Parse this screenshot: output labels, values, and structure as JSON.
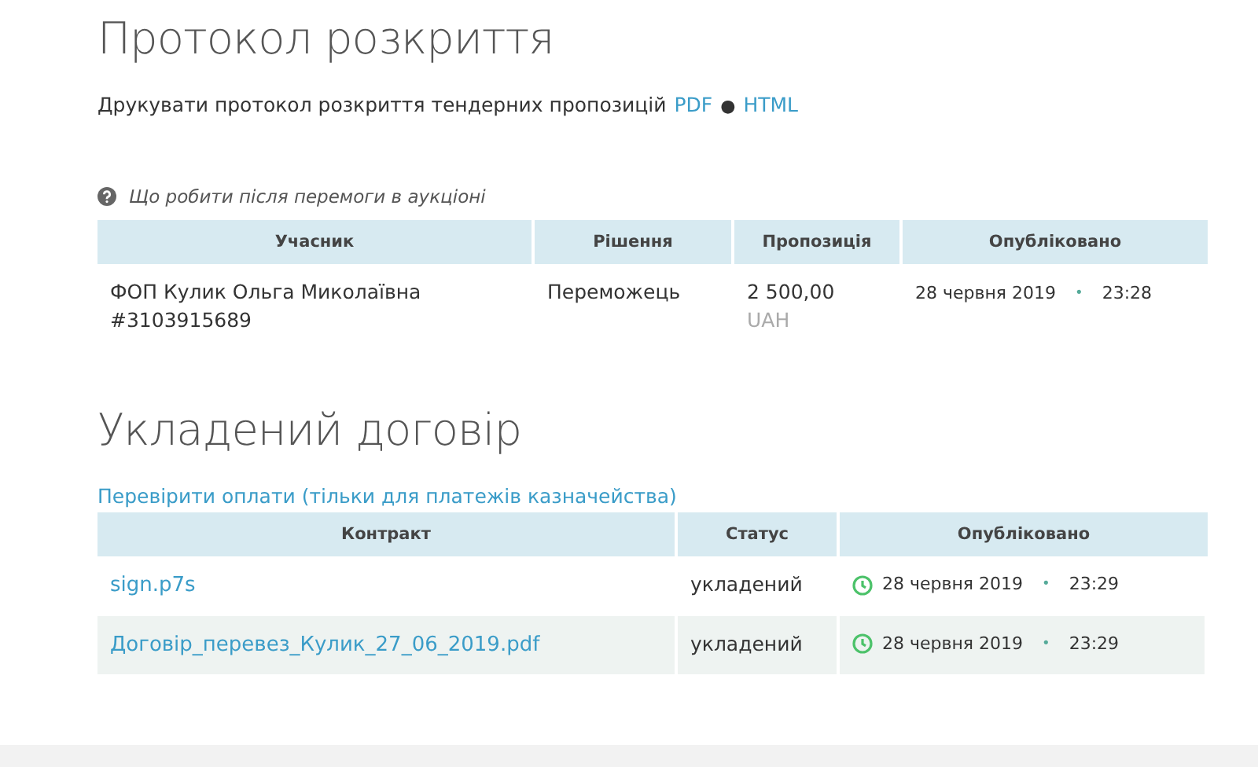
{
  "tender_protocol": {
    "title": "Протокол розкриття",
    "print_text": "Друкувати протокол розкриття тендерних пропозицій",
    "print_links": [
      {
        "label": "PDF"
      },
      {
        "label": "HTML"
      }
    ],
    "print_separator": "●",
    "help_link": "Що робити після перемоги в аукціоні",
    "table": {
      "columns": [
        "Учасник",
        "Рішення",
        "Пропозиція",
        "Опубліковано"
      ],
      "rows": [
        {
          "cells": [
            {
              "kind": "text",
              "lines": [
                "ФОП Кулик Ольга Миколаївна",
                "#3103915689"
              ]
            },
            {
              "kind": "text",
              "lines": [
                "Переможець"
              ]
            },
            {
              "kind": "amount",
              "value": "2 500,00",
              "currency": "UAH"
            },
            {
              "kind": "date",
              "date": "28 червня 2019",
              "separator": "•",
              "time": "23:28",
              "icon": false
            }
          ]
        }
      ]
    }
  },
  "contract": {
    "title": "Укладений договір",
    "payments_link": "Перевірити оплати (тільки для платежів казначейства)",
    "table": {
      "columns": [
        "Контракт",
        "Статус",
        "Опубліковано"
      ],
      "rows": [
        {
          "cells": [
            {
              "kind": "link",
              "lines": [
                "sign.p7s"
              ]
            },
            {
              "kind": "text",
              "lines": [
                "укладений"
              ]
            },
            {
              "kind": "date",
              "date": "28 червня 2019",
              "separator": "•",
              "time": "23:29",
              "icon": true
            }
          ]
        },
        {
          "cells": [
            {
              "kind": "link",
              "lines": [
                "Договір_перевез_Кулик_27_06_2019.pdf"
              ]
            },
            {
              "kind": "text",
              "lines": [
                "укладений"
              ]
            },
            {
              "kind": "date",
              "date": "28 червня 2019",
              "separator": "•",
              "time": "23:29",
              "icon": true
            }
          ]
        }
      ]
    }
  }
}
